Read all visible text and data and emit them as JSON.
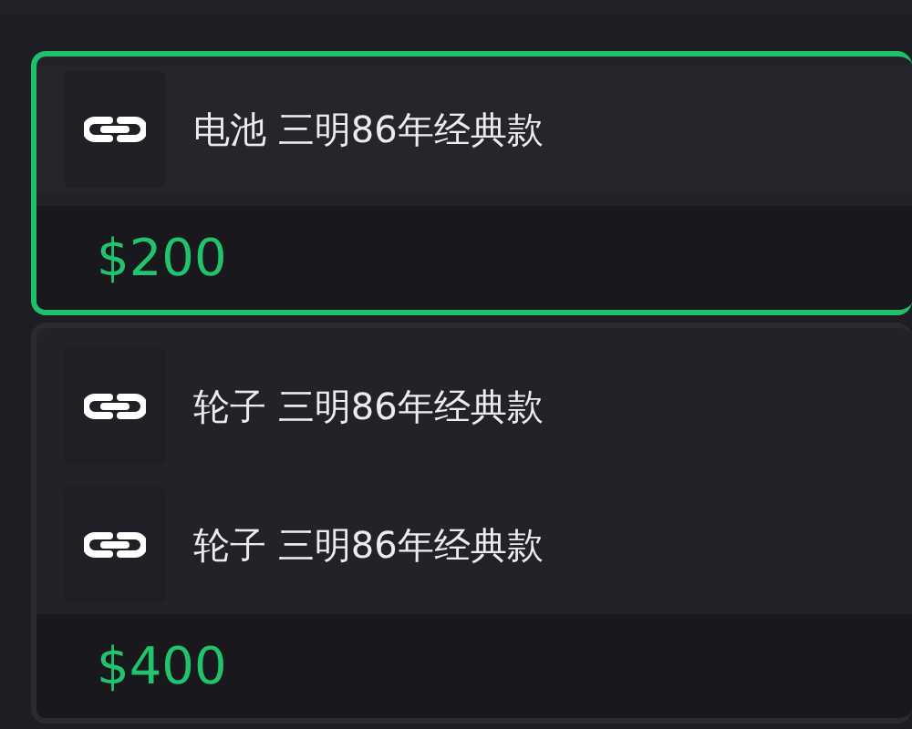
{
  "cards": [
    {
      "selected": true,
      "items": [
        {
          "title": "电池 三明86年经典款"
        }
      ],
      "price": "$200"
    },
    {
      "selected": false,
      "items": [
        {
          "title": "轮子 三明86年经典款"
        },
        {
          "title": "轮子 三明86年经典款"
        }
      ],
      "price": "$400"
    }
  ]
}
